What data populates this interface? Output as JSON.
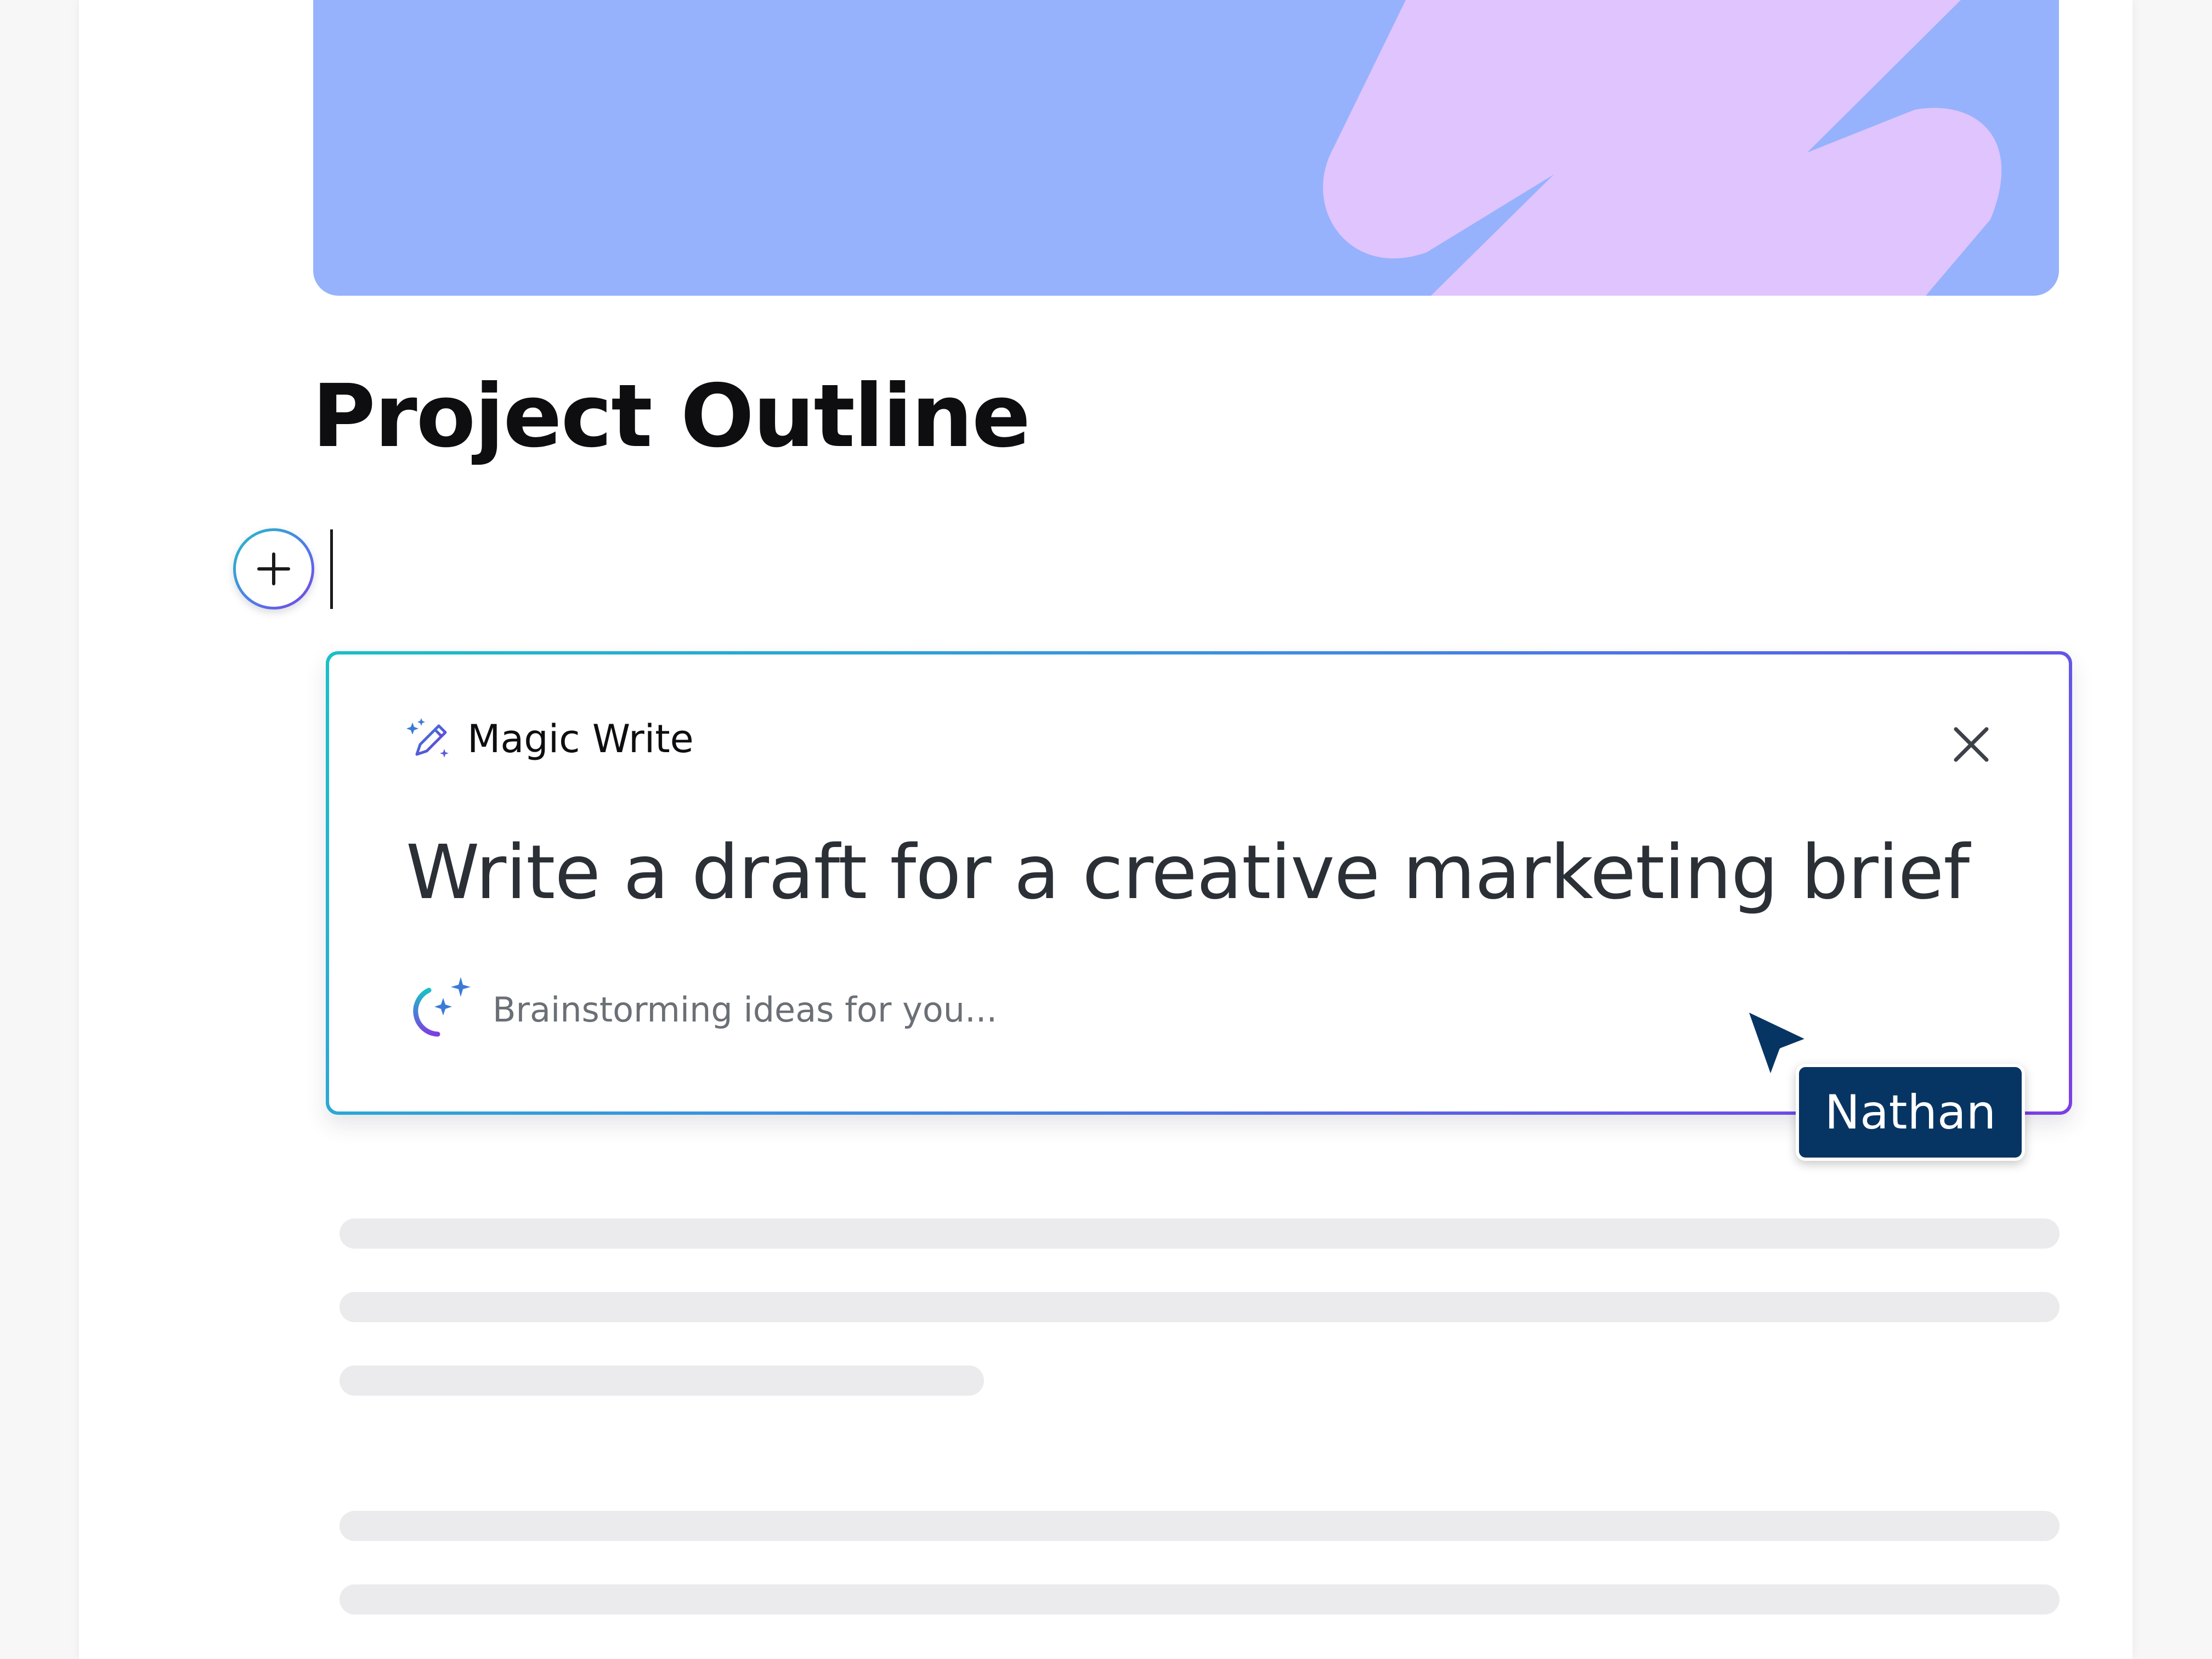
{
  "document": {
    "title": "Project Outline"
  },
  "magic_write": {
    "label": "Magic Write",
    "prompt": "Write a draft for a creative marketing brief",
    "status": "Brainstorming ideas for you..."
  },
  "collaborator": {
    "name": "Nathan"
  },
  "colors": {
    "banner_blue": "#96b2fc",
    "banner_lilac": "#e0c4fe",
    "collaborator": "#073563",
    "skeleton": "#ebebee"
  },
  "icons": {
    "add": "plus-icon",
    "magic_write": "magic-pencil-icon",
    "close": "close-icon",
    "status": "sparkle-loading-icon",
    "cursor": "cursor-arrow-icon"
  }
}
